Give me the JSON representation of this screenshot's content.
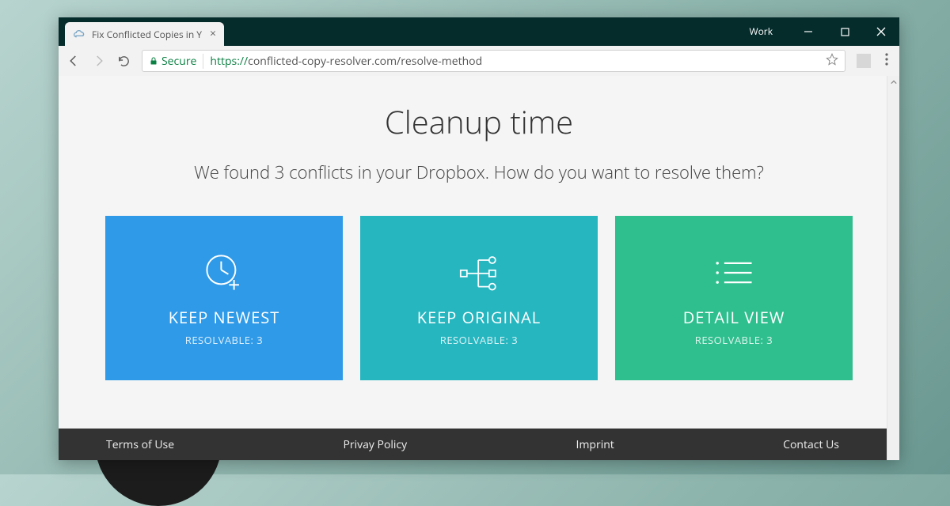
{
  "window": {
    "profile_label": "Work"
  },
  "tab": {
    "title": "Fix Conflicted Copies in Y"
  },
  "address": {
    "secure_label": "Secure",
    "protocol": "https://",
    "rest": "conflicted-copy-resolver.com/resolve-method"
  },
  "page": {
    "title": "Cleanup time",
    "subtitle": "We found 3 conflicts in your Dropbox. How do you want to resolve them?"
  },
  "cards": [
    {
      "title": "KEEP NEWEST",
      "subtitle": "RESOLVABLE: 3",
      "color": "blue"
    },
    {
      "title": "KEEP ORIGINAL",
      "subtitle": "RESOLVABLE: 3",
      "color": "teal"
    },
    {
      "title": "DETAIL VIEW",
      "subtitle": "RESOLVABLE: 3",
      "color": "green"
    }
  ],
  "footer": {
    "terms": "Terms of Use",
    "privacy": "Privay Policy",
    "imprint": "Imprint",
    "contact": "Contact Us"
  }
}
